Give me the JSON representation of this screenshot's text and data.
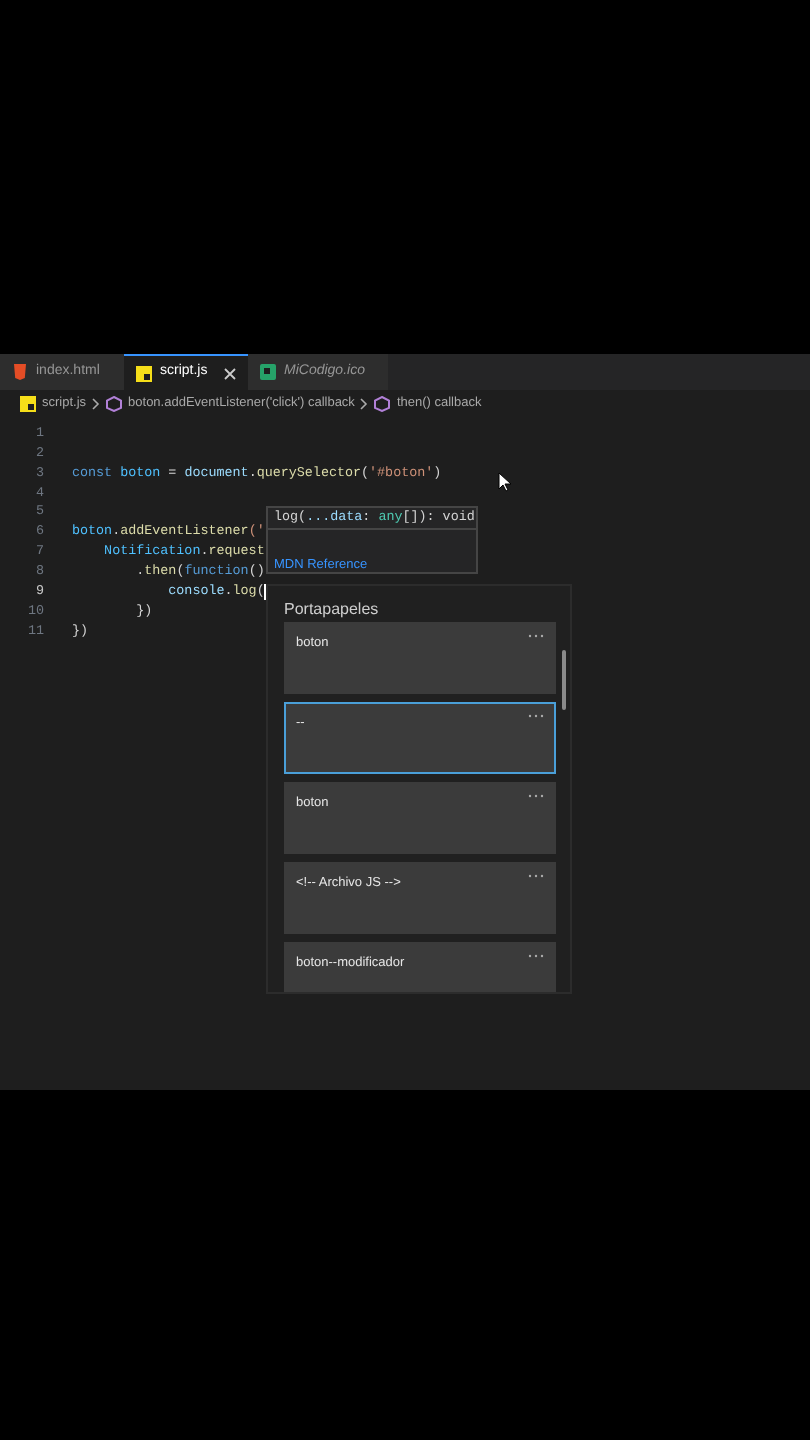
{
  "tabs": [
    {
      "label": "index.html",
      "kind": "html",
      "selected": false,
      "italic": false
    },
    {
      "label": "script.js",
      "kind": "js",
      "selected": true,
      "italic": false
    },
    {
      "label": "MiCodigo.ico",
      "kind": "image",
      "selected": false,
      "italic": true
    }
  ],
  "breadcrumb": [
    {
      "label": "script.js",
      "kind": "js"
    },
    {
      "label": "boton.addEventListener('click') callback",
      "kind": "symbol"
    },
    {
      "label": "then() callback",
      "kind": "symbol"
    }
  ],
  "code": [
    {
      "number": "1",
      "current": false
    },
    {
      "number": "2",
      "current": false
    },
    {
      "number": "3",
      "current": false,
      "tokens": [
        {
          "text": "const ",
          "kind": "keyword"
        },
        {
          "text": "boton",
          "kind": "constant"
        },
        {
          "text": " = ",
          "kind": "plain"
        },
        {
          "text": "document",
          "kind": "variable"
        },
        {
          "text": ".",
          "kind": "plain"
        },
        {
          "text": "querySelector",
          "kind": "function"
        },
        {
          "text": "(",
          "kind": "plain"
        },
        {
          "text": "'#boton'",
          "kind": "string"
        },
        {
          "text": ")",
          "kind": "plain"
        }
      ]
    },
    {
      "number": "4",
      "current": false
    },
    {
      "number": "5",
      "current": false
    },
    {
      "number": "6",
      "current": false,
      "tokens": [
        {
          "text": "boton",
          "kind": "constant"
        },
        {
          "text": ".",
          "kind": "plain"
        },
        {
          "text": "addEventListener",
          "kind": "function"
        },
        {
          "text": "('",
          "kind": "string"
        }
      ]
    },
    {
      "number": "7",
      "current": false,
      "tokens": [
        {
          "text": "    Notification",
          "kind": "constant"
        },
        {
          "text": ".",
          "kind": "plain"
        },
        {
          "text": "request",
          "kind": "function"
        }
      ]
    },
    {
      "number": "8",
      "current": false,
      "tokens": [
        {
          "text": "        .",
          "kind": "plain"
        },
        {
          "text": "then",
          "kind": "function"
        },
        {
          "text": "(",
          "kind": "plain"
        },
        {
          "text": "function",
          "kind": "keyword"
        },
        {
          "text": "()",
          "kind": "plain"
        }
      ]
    },
    {
      "number": "9",
      "tokens": [
        {
          "text": "            console",
          "kind": "variable"
        },
        {
          "text": ".",
          "kind": "plain"
        },
        {
          "text": "log",
          "kind": "function"
        },
        {
          "text": "(",
          "kind": "plain"
        }
      ],
      "current": true
    },
    {
      "number": "10",
      "current": false,
      "tokens": [
        {
          "text": "        })",
          "kind": "plain"
        }
      ]
    },
    {
      "number": "11",
      "current": false,
      "tokens": [
        {
          "text": "})",
          "kind": "plain"
        }
      ]
    }
  ],
  "hover": {
    "signature": [
      {
        "text": "log(",
        "kind": "plain"
      },
      {
        "text": "...data",
        "kind": "variable"
      },
      {
        "text": ": ",
        "kind": "plain"
      },
      {
        "text": "any",
        "kind": "type"
      },
      {
        "text": "[]",
        "kind": "plain"
      },
      {
        "text": "): void",
        "kind": "plain"
      }
    ],
    "link": "MDN Reference"
  },
  "clipboard": {
    "title": "Portapapeles",
    "items": [
      {
        "text": "boton",
        "selected": false
      },
      {
        "text": "--",
        "selected": true
      },
      {
        "text": "boton",
        "selected": false
      },
      {
        "text": "<!-- Archivo JS -->",
        "selected": false
      },
      {
        "text": "boton--modificador",
        "selected": false
      }
    ]
  }
}
